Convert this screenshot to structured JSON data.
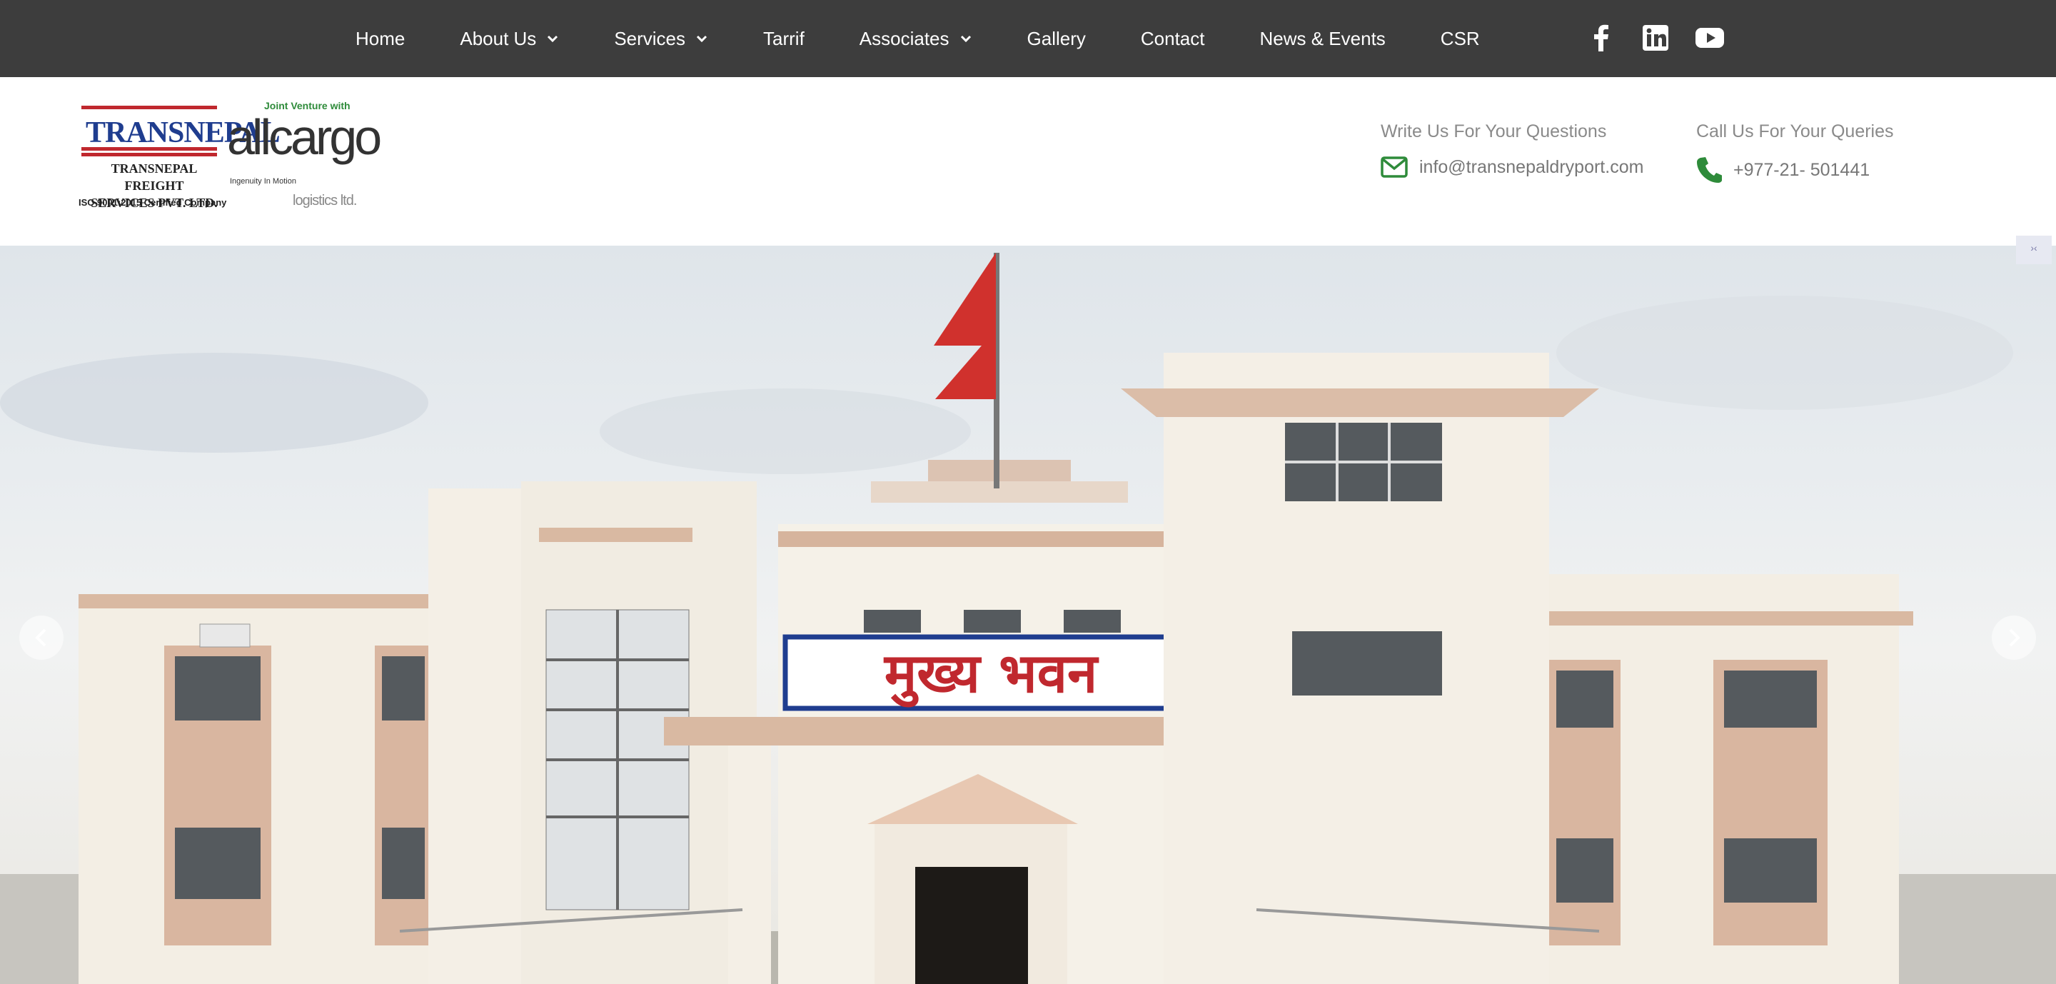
{
  "nav": {
    "items": [
      {
        "label": "Home",
        "dropdown": false
      },
      {
        "label": "About Us",
        "dropdown": true
      },
      {
        "label": "Services",
        "dropdown": true
      },
      {
        "label": "Tarrif",
        "dropdown": false
      },
      {
        "label": "Associates",
        "dropdown": true
      },
      {
        "label": "Gallery",
        "dropdown": false
      },
      {
        "label": "Contact",
        "dropdown": false
      },
      {
        "label": "News & Events",
        "dropdown": false
      },
      {
        "label": "CSR",
        "dropdown": false
      }
    ],
    "social_icons": [
      "facebook-icon",
      "linkedin-icon",
      "youtube-icon"
    ]
  },
  "logo": {
    "brand": "TRANSNEPAL",
    "company_line1": "TRANSNEPAL FREIGHT",
    "company_line2": "SERVICES PVT. LTD.",
    "certification": "ISO 9001:2015 Certified Company",
    "jv_text": "Joint Venture with",
    "partner": "allcargo",
    "partner_tagline": "Ingenuity In Motion",
    "partner_suffix": "logistics ltd."
  },
  "contact": {
    "email_label": "Write Us For Your Questions",
    "email": "info@transnepaldryport.com",
    "phone_label": "Call Us For Your Queries",
    "phone": "+977-21- 501441"
  },
  "hero": {
    "sign_text": "मुख्य भवन",
    "corner_control": "›‹"
  },
  "colors": {
    "topbar": "#3d3d3d",
    "icon_green": "#2e8b3a",
    "brand_blue": "#1f3d8f",
    "brand_red": "#c0282e"
  }
}
